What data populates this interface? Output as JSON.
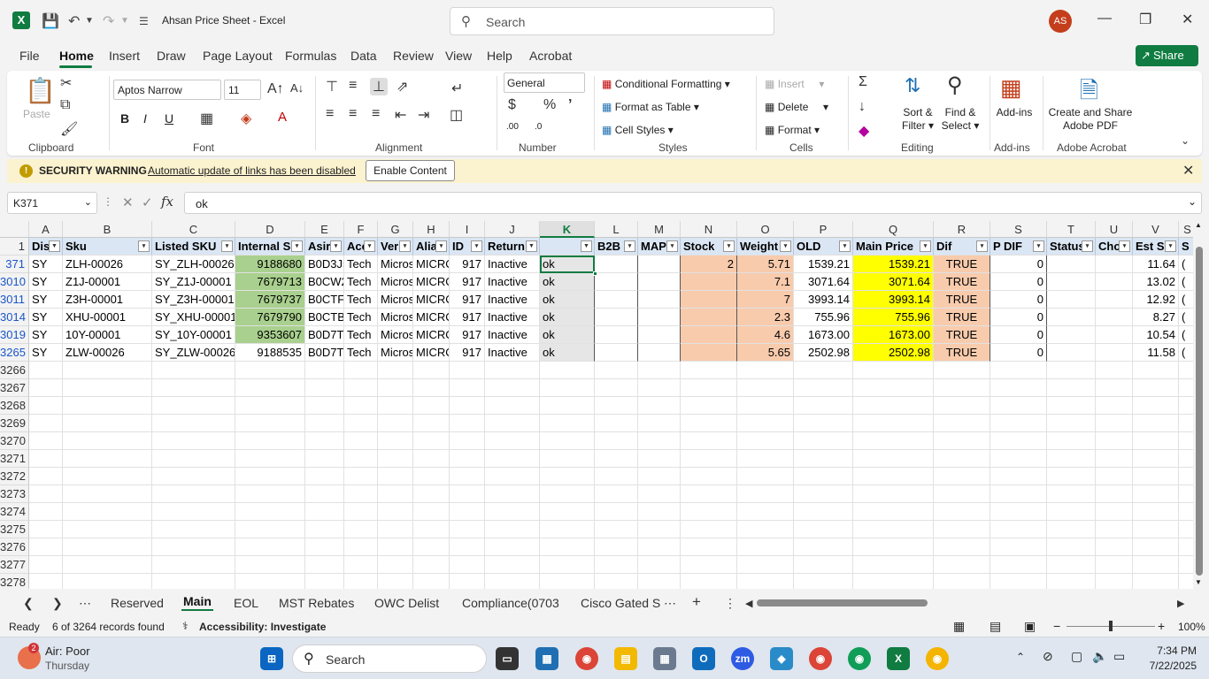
{
  "window": {
    "title": "Ahsan Price Sheet  -  Excel",
    "search_placeholder": "Search",
    "avatar": "AS"
  },
  "menu": {
    "tabs": [
      "File",
      "Home",
      "Insert",
      "Draw",
      "Page Layout",
      "Formulas",
      "Data",
      "Review",
      "View",
      "Help",
      "Acrobat"
    ],
    "share": "Share"
  },
  "ribbon": {
    "clipboard": {
      "paste": "Paste",
      "label": "Clipboard"
    },
    "font": {
      "name": "Aptos Narrow",
      "size": "11",
      "label": "Font"
    },
    "alignment": {
      "label": "Alignment"
    },
    "number": {
      "format": "General",
      "label": "Number"
    },
    "styles": {
      "conditional": "Conditional Formatting",
      "table": "Format as Table",
      "cell": "Cell Styles",
      "label": "Styles"
    },
    "cells": {
      "insert": "Insert",
      "delete": "Delete",
      "format": "Format",
      "label": "Cells"
    },
    "editing": {
      "sort1": "Sort &",
      "sort2": "Filter",
      "find1": "Find &",
      "find2": "Select",
      "label": "Editing"
    },
    "addins": {
      "btn": "Add-ins",
      "label": "Add-ins"
    },
    "acrobat": {
      "btn1": "Create and Share",
      "btn2": "Adobe PDF",
      "label": "Adobe Acrobat"
    }
  },
  "security": {
    "title": "SECURITY WARNING",
    "message": "Automatic update of links has been disabled",
    "button": "Enable Content"
  },
  "formula_bar": {
    "name_box": "K371",
    "formula": "ok"
  },
  "sheet": {
    "columns": [
      "A",
      "B",
      "C",
      "D",
      "E",
      "F",
      "G",
      "H",
      "I",
      "J",
      "K",
      "L",
      "M",
      "N",
      "O",
      "P",
      "Q",
      "R",
      "S",
      "T",
      "U",
      "V",
      "S"
    ],
    "headers": [
      "Dis",
      "Sku",
      "Listed SKU",
      "Internal S",
      "Asir",
      "Acc",
      "Ver",
      "Alia",
      "ID",
      "Return",
      "",
      "B2B",
      "MAP",
      "Stock",
      "Weight",
      "OLD",
      "Main Price",
      "Dif",
      "P DIF",
      "Status",
      "Cho",
      "Est S",
      "S"
    ],
    "row_numbers": [
      "1",
      "371",
      "3010",
      "3011",
      "3014",
      "3019",
      "3265",
      "3266",
      "3267",
      "3268",
      "3269",
      "3270",
      "3271",
      "3272",
      "3273",
      "3274",
      "3275",
      "3276",
      "3277",
      "3278"
    ],
    "rows": [
      [
        "SY",
        "ZLH-00026",
        "SY_ZLH-00026",
        "9188680",
        "B0D3J5",
        "Tech",
        "Micros",
        "MICRO",
        "917",
        "Inactive",
        "ok",
        "",
        "",
        "2",
        "5.71",
        "1539.21",
        "1539.21",
        "TRUE",
        "0",
        "",
        "",
        "11.64",
        "("
      ],
      [
        "SY",
        "Z1J-00001",
        "SY_Z1J-00001",
        "7679713",
        "B0CW2",
        "Tech",
        "Micros",
        "MICRO",
        "917",
        "Inactive",
        "ok",
        "",
        "",
        "",
        "7.1",
        "3071.64",
        "3071.64",
        "TRUE",
        "0",
        "",
        "",
        "13.02",
        "("
      ],
      [
        "SY",
        "Z3H-00001",
        "SY_Z3H-00001",
        "7679737",
        "B0CTF7",
        "Tech",
        "Micros",
        "MICRO",
        "917",
        "Inactive",
        "ok",
        "",
        "",
        "",
        "7",
        "3993.14",
        "3993.14",
        "TRUE",
        "0",
        "",
        "",
        "12.92",
        "("
      ],
      [
        "SY",
        "XHU-00001",
        "SY_XHU-00001",
        "7679790",
        "B0CTB6",
        "Tech",
        "Micros",
        "MICRO",
        "917",
        "Inactive",
        "ok",
        "",
        "",
        "",
        "2.3",
        "755.96",
        "755.96",
        "TRUE",
        "0",
        "",
        "",
        "8.27",
        "("
      ],
      [
        "SY",
        "10Y-00001",
        "SY_10Y-00001",
        "9353607",
        "B0D7TI",
        "Tech",
        "Micros",
        "MICRO",
        "917",
        "Inactive",
        "ok",
        "",
        "",
        "",
        "4.6",
        "1673.00",
        "1673.00",
        "TRUE",
        "0",
        "",
        "",
        "10.54",
        "("
      ],
      [
        "SY",
        "ZLW-00026",
        "SY_ZLW-00026",
        "9188535",
        "B0D7T(",
        "Tech",
        "Micros",
        "MICRO",
        "917",
        "Inactive",
        "ok",
        "",
        "",
        "",
        "5.65",
        "2502.98",
        "2502.98",
        "TRUE",
        "0",
        "",
        "",
        "11.58",
        "("
      ]
    ]
  },
  "sheet_tabs": [
    "Reserved",
    "Main",
    "EOL",
    "MST Rebates",
    "OWC Delist",
    "Compliance(0703",
    "Cisco Gated S"
  ],
  "status": {
    "ready": "Ready",
    "records": "6 of 3264 records found",
    "accessibility": "Accessibility: Investigate",
    "zoom": "100%"
  },
  "taskbar": {
    "weather_title": "Air: Poor",
    "weather_day": "Thursday",
    "weather_badge": "2",
    "search": "Search",
    "time": "7:34 PM",
    "date": "7/22/2025"
  },
  "colors": {
    "excel_green": "#107c41",
    "header_fill": "#dbe6f4",
    "green_fill": "#a9d08e",
    "salmon_fill": "#f8cbad",
    "yellow_fill": "#ffff00",
    "gray_fill": "#e7e6e6"
  }
}
